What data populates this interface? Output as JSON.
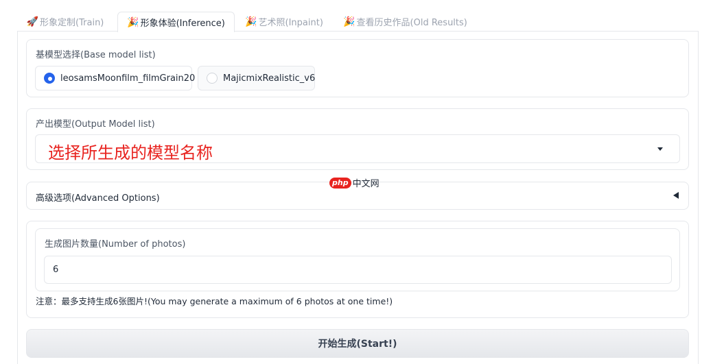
{
  "tabs": [
    {
      "emoji": "🚀",
      "label": "形象定制(Train)",
      "active": false
    },
    {
      "emoji": "🎉",
      "label": "形象体验(Inference)",
      "active": true
    },
    {
      "emoji": "🎉",
      "label": "艺术照(Inpaint)",
      "active": false
    },
    {
      "emoji": "🎉",
      "label": "查看历史作品(Old Results)",
      "active": false
    }
  ],
  "base_model": {
    "label": "基模型选择(Base model list)",
    "options": [
      {
        "label": "leosamsMoonfilm_filmGrain20",
        "selected": true
      },
      {
        "label": "MajicmixRealistic_v6",
        "selected": false
      }
    ]
  },
  "output_model": {
    "label": "产出模型(Output Model list)",
    "annotation": "选择所生成的模型名称",
    "annotation_color": "#e8231f"
  },
  "advanced": {
    "label": "高级选项(Advanced Options)",
    "expanded": false
  },
  "num_photos": {
    "label": "生成图片数量(Number of photos)",
    "value": "6"
  },
  "note": "注意：最多支持生成6张图片!(You may generate a maximum of 6 photos at one time!)",
  "start_button": "开始生成(Start!)",
  "watermark": {
    "php": "php",
    "cn": "中文网"
  },
  "colors": {
    "accent": "#2563eb",
    "border": "#e5e7eb",
    "annotation": "#e8231f"
  }
}
